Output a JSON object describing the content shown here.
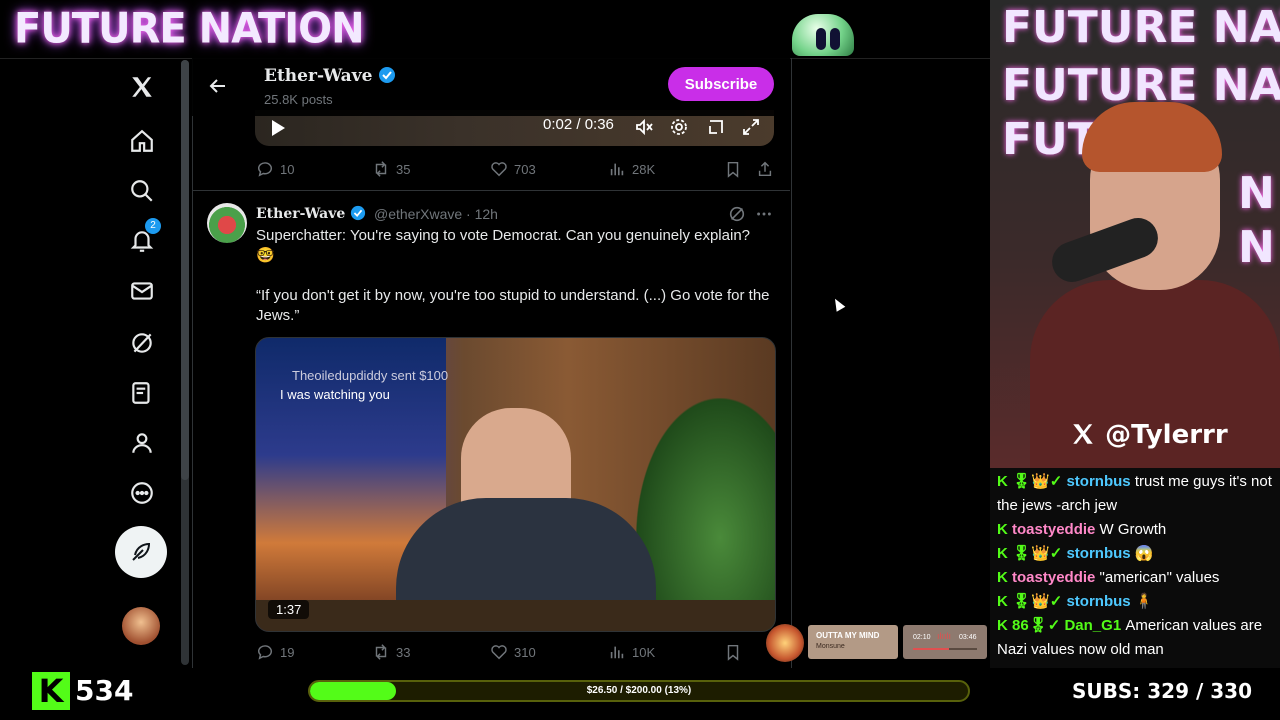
{
  "overlay": {
    "brand": "FUTURE NATION"
  },
  "header": {
    "name": "Ether-Wave",
    "posts": "25.8K posts",
    "subscribe_label": "Subscribe"
  },
  "video_player": {
    "time": "0:02 / 0:36"
  },
  "post1_actions": {
    "replies": "10",
    "reposts": "35",
    "likes": "703",
    "views": "28K"
  },
  "tweet": {
    "name": "Ether-Wave",
    "handle": "@etherXwave · 12h",
    "text1": "Superchatter: You're saying to vote Democrat. Can you genuinely explain? 🤓",
    "text2": "“If you don't get it by now, you're too stupid to understand. (...) Go vote for the Jews.”",
    "media_duration": "1:37",
    "overlay_donor": "Theoiledupdiddy sent $100",
    "overlay_message": "I was watching you",
    "actions": {
      "replies": "19",
      "reposts": "33",
      "likes": "310",
      "views": "10K"
    }
  },
  "sidebar": {
    "notification_count": "2"
  },
  "webcam": {
    "titles": [
      "FUTURE NATION",
      "FUTURE NATION",
      "FUTUR",
      "N",
      "N"
    ],
    "handle": "@Tylerrr"
  },
  "chat": [
    {
      "user": "stornbus",
      "message": "trust me guys it's not the jews -arch jew",
      "badges": "K 🎖👑✓",
      "color": "user1"
    },
    {
      "user": "toastyeddie",
      "message": "W Growth",
      "badges": "K",
      "color": "user2"
    },
    {
      "user": "stornbus",
      "message": "😱",
      "badges": "K 🎖👑✓",
      "color": "user1"
    },
    {
      "user": "toastyeddie",
      "message": "\"american\" values",
      "badges": "K",
      "color": "user2"
    },
    {
      "user": "stornbus",
      "message": "🧍",
      "badges": "K 🎖👑✓",
      "color": "user1"
    },
    {
      "user": "Dan_G1",
      "message": "American values are Nazi values now old man",
      "badges": "K 86🎖✓",
      "color": "user3"
    }
  ],
  "music": {
    "title": "OUTTA MY MIND",
    "artist": "Monsune",
    "elapsed": "02:10",
    "total": "03:46"
  },
  "bottom": {
    "viewers": "534",
    "goal_text": "$26.50 / $200.00 (13%)",
    "goal_fraction": 0.13,
    "subs": "SUBS:  329 / 330"
  },
  "colors": {
    "accent": "#c92ee8",
    "kick_green": "#53fc18",
    "x_gray": "#71767b"
  }
}
